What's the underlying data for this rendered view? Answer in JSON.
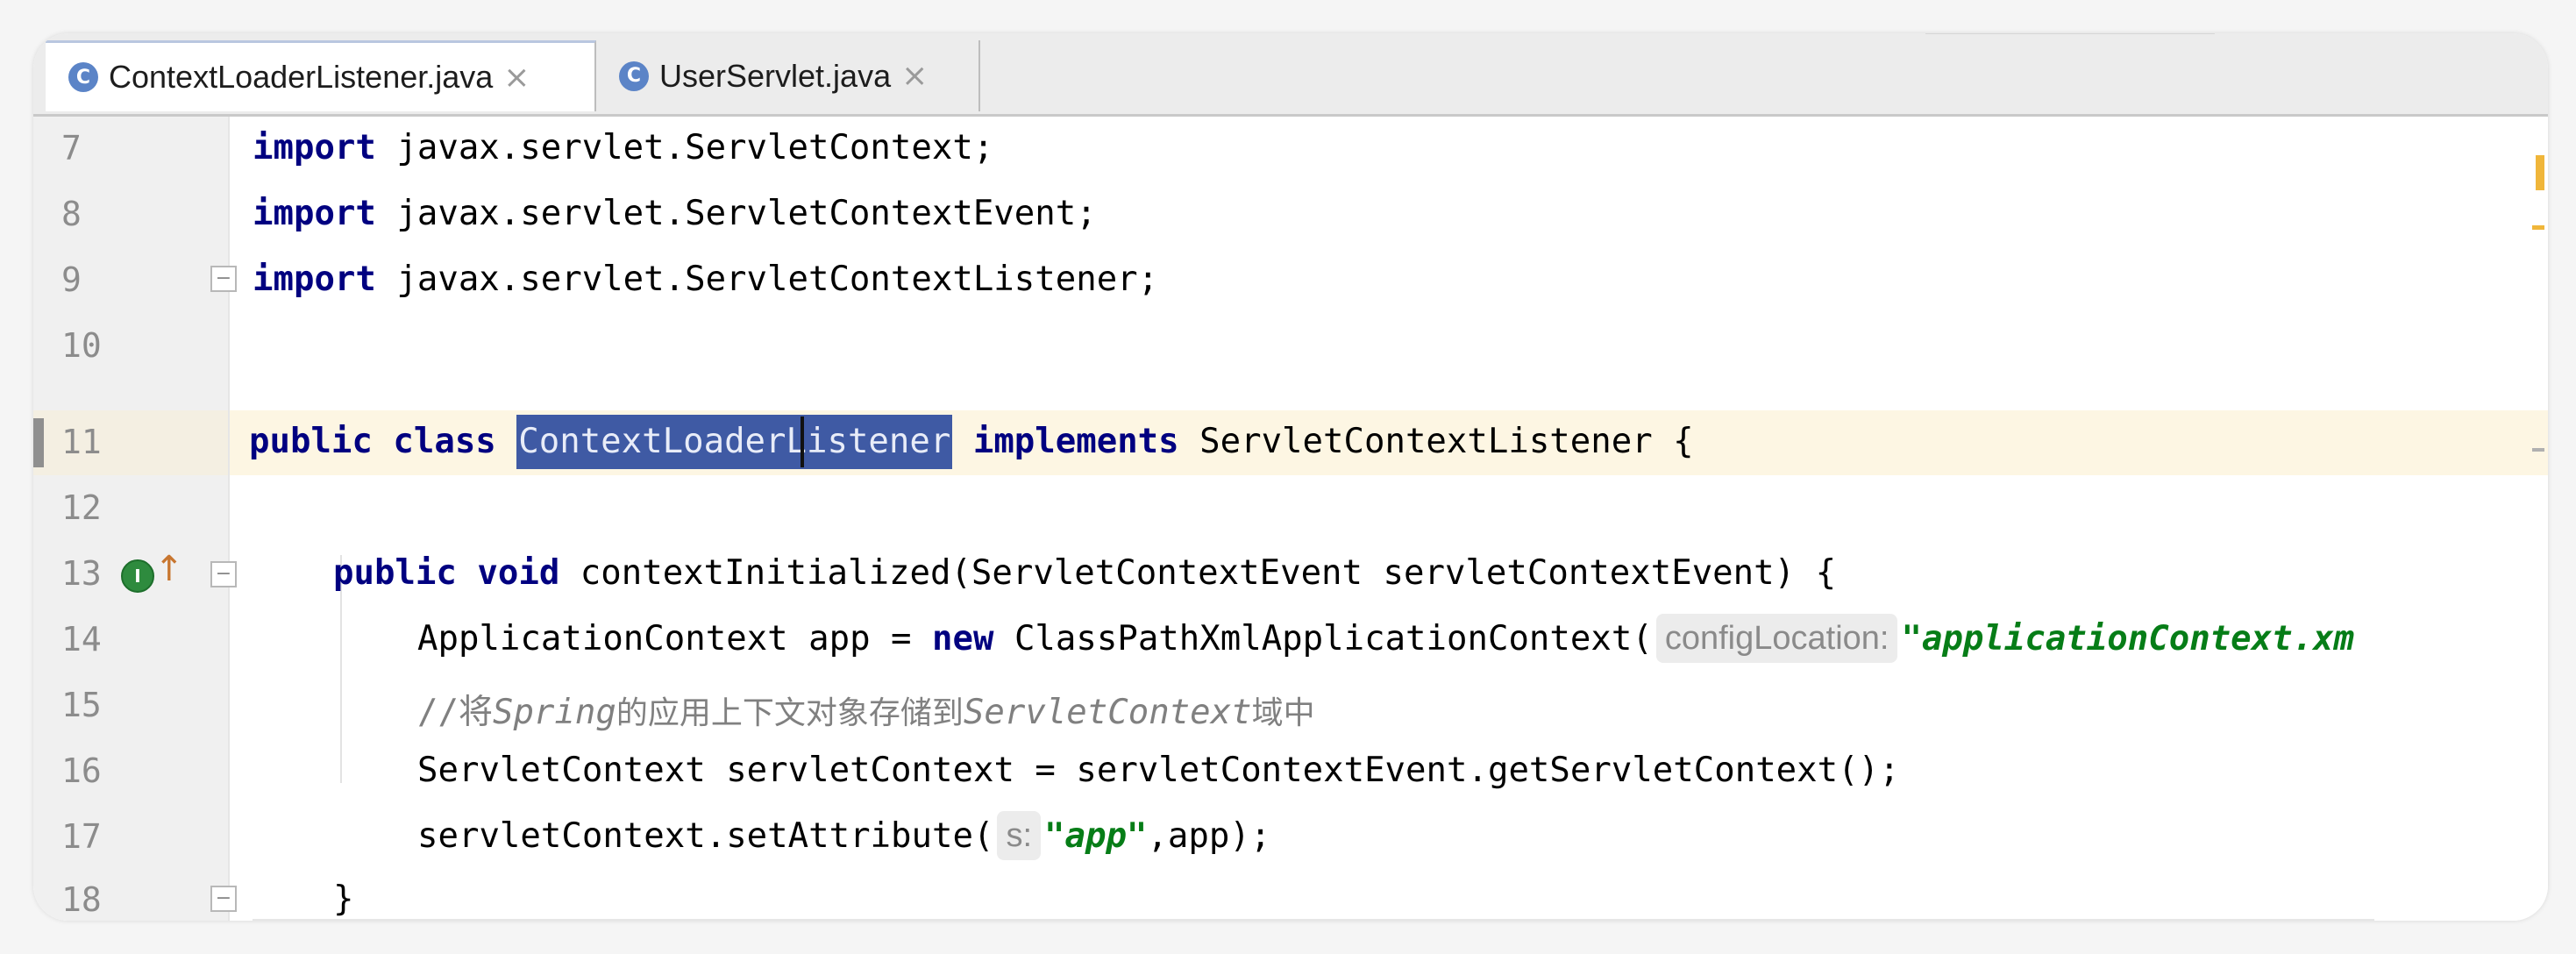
{
  "tabs": [
    {
      "label": "ContextLoaderListener.java",
      "icon": "C",
      "close": "×",
      "active": true
    },
    {
      "label": "UserServlet.java",
      "icon": "C",
      "close": "×",
      "active": false
    }
  ],
  "editor": {
    "lines": [
      {
        "num": "7"
      },
      {
        "num": "8"
      },
      {
        "num": "9"
      },
      {
        "num": "10"
      },
      {
        "num": "11"
      },
      {
        "num": "12"
      },
      {
        "num": "13"
      },
      {
        "num": "14"
      },
      {
        "num": "15"
      },
      {
        "num": "16"
      },
      {
        "num": "17"
      },
      {
        "num": "18"
      }
    ],
    "tokens": {
      "import_kw": "import",
      "imp1": "javax.servlet.ServletContext;",
      "imp2": "javax.servlet.ServletContextEvent;",
      "imp3": "javax.servlet.ServletContextListener;",
      "public_kw": "public",
      "class_kw": "class",
      "class_name": "ContextLoaderListener",
      "implements_kw": "implements",
      "iface": "ServletContextListener {",
      "void_kw": "void",
      "method_sig": "contextInitialized(ServletContextEvent servletContextEvent) {",
      "app_decl": "ApplicationContext app = ",
      "new_kw": "new",
      "cpx": "ClassPathXmlApplicationContext(",
      "hint_config": "configLocation:",
      "app_str": "\"applicationContext.xm",
      "comment_a": "//将",
      "comment_b": "Spring",
      "comment_c": "的应用上下文对象存储到",
      "comment_d": "ServletContext",
      "comment_e": "域中",
      "sc_line": "ServletContext servletContext = servletContextEvent.getServletContext();",
      "set_attr": "servletContext.setAttribute(",
      "hint_s": "s:",
      "app_lit": "\"app\"",
      "set_attr_end": ",app);",
      "close_brace": "}"
    }
  },
  "gutter_icons": {
    "implements_icon": "I",
    "up_arrow": "↑"
  },
  "colors": {
    "keyword": "#000080",
    "string": "#067d17",
    "comment": "#808080",
    "selection": "#3f5aa4",
    "caret_row": "#fdf6e3"
  }
}
